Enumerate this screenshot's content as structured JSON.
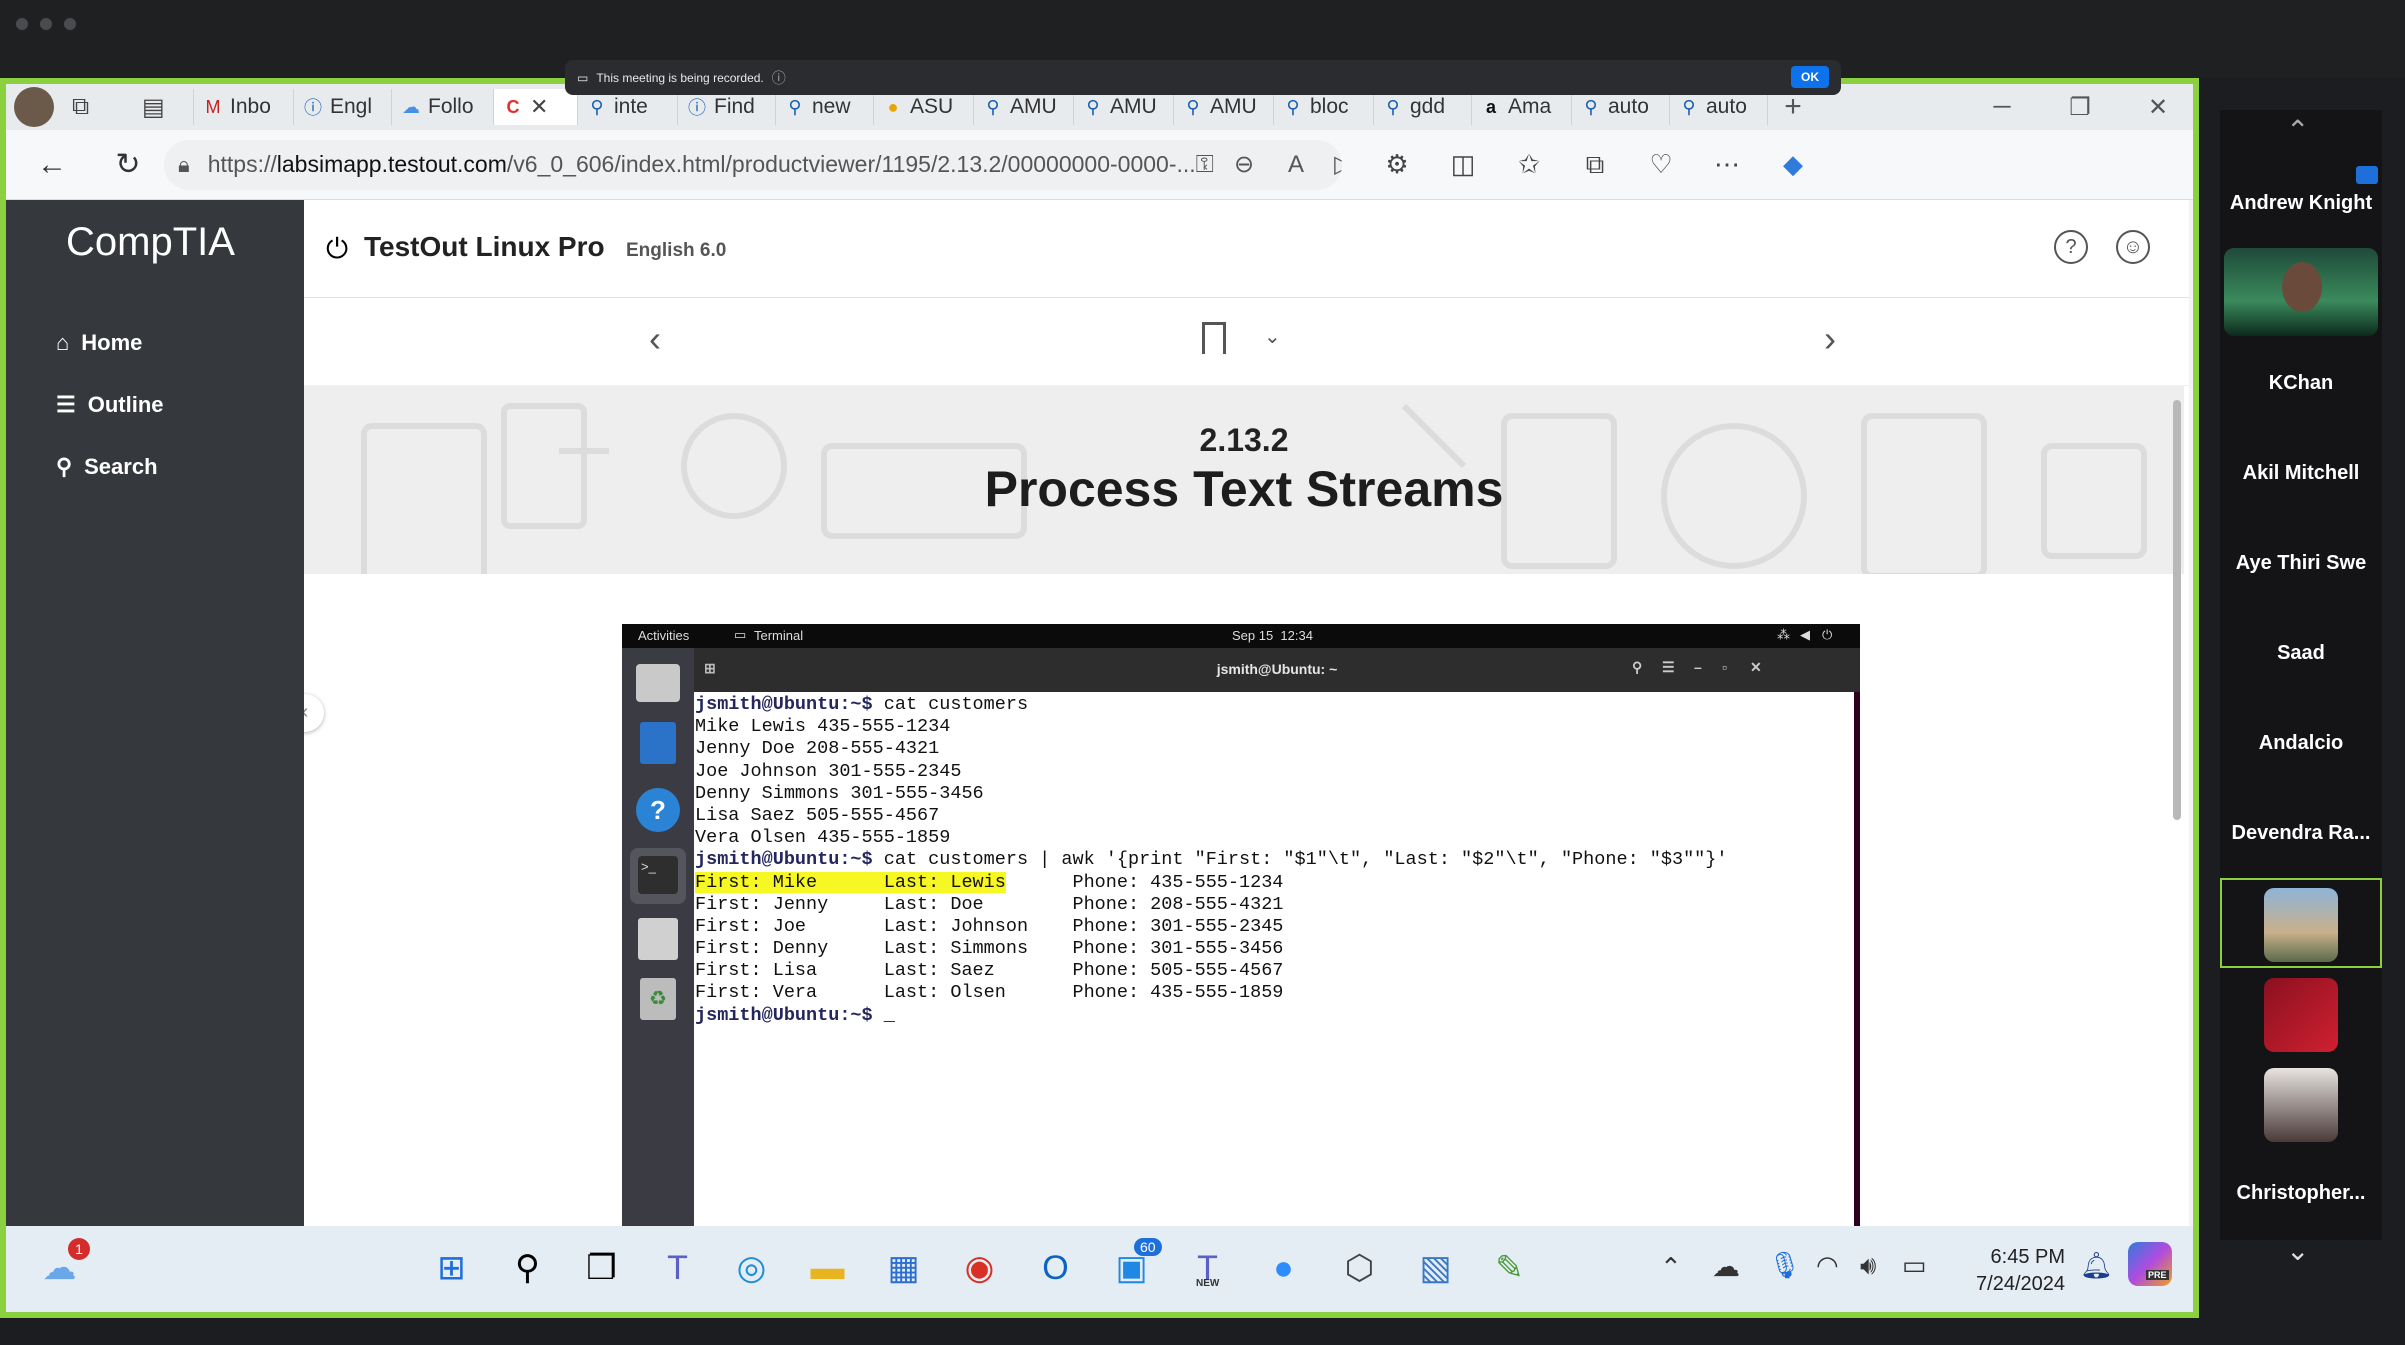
{
  "recording": {
    "text": "This meeting is being recorded.",
    "ok": "OK"
  },
  "browser": {
    "tabs": [
      "Inbo",
      "Engl",
      "Follo",
      "inte",
      "Find",
      "new",
      "ASU",
      "AMU",
      "AMU",
      "AMU",
      "bloc",
      "gdd",
      "Ama",
      "auto",
      "auto"
    ],
    "url_prefix": "https://",
    "url_domain": "labsimapp.testout.com",
    "url_path": "/v6_0_606/index.html/productviewer/1195/2.13.2/00000000-0000-..."
  },
  "sidebar": {
    "logo": "CompTIA",
    "items": [
      {
        "label": "Home",
        "icon": "home-icon"
      },
      {
        "label": "Outline",
        "icon": "list-icon"
      },
      {
        "label": "Search",
        "icon": "search-icon"
      }
    ]
  },
  "course": {
    "title": "TestOut Linux Pro",
    "language": "English 6.0"
  },
  "section": {
    "number": "2.13.2",
    "title": "Process Text Streams"
  },
  "vm": {
    "activities": "Activities",
    "app": "Terminal",
    "clock": "Sep 15  12:34",
    "window_title": "jsmith@Ubuntu: ~"
  },
  "terminal": {
    "prompt": "jsmith@Ubuntu:~$",
    "cmd1": " cat customers",
    "out1": [
      "Mike Lewis 435-555-1234",
      "Jenny Doe 208-555-4321",
      "Joe Johnson 301-555-2345",
      "Denny Simmons 301-555-3456",
      "Lisa Saez 505-555-4567",
      "Vera Olsen 435-555-1859"
    ],
    "cmd2": " cat customers | awk '{print \"First: \"$1\"\\t\", \"Last: \"$2\"\\t\", \"Phone: \"$3\"\"}'",
    "out2": [
      "First: Mike      Last: Lewis      Phone: 435-555-1234",
      "First: Jenny     Last: Doe        Phone: 208-555-4321",
      "First: Joe       Last: Johnson    Phone: 301-555-2345",
      "First: Denny     Last: Simmons    Phone: 301-555-3456",
      "First: Lisa      Last: Saez       Phone: 505-555-4567",
      "First: Vera      Last: Olsen      Phone: 435-555-1859"
    ],
    "highlight": "First: Mike      Last: Lewis",
    "highlight_rest": "      Phone: 435-555-1234",
    "cursor": " _"
  },
  "taskbar": {
    "weather_badge": "1",
    "teams_badge": "60",
    "new_label": "NEW",
    "pre_label": "PRE",
    "time": "6:45 PM",
    "date": "7/24/2024"
  },
  "participants": [
    "Andrew Knight",
    "KChan",
    "Akil Mitchell",
    "Aye Thiri Swe",
    "Saad",
    "Andalcio",
    "Devendra Ra...",
    "Christopher..."
  ],
  "colors": {
    "share_border": "#8bd13f",
    "highlight": "#f7f724",
    "prompt": "#24265e",
    "sidebar": "#35383c"
  }
}
